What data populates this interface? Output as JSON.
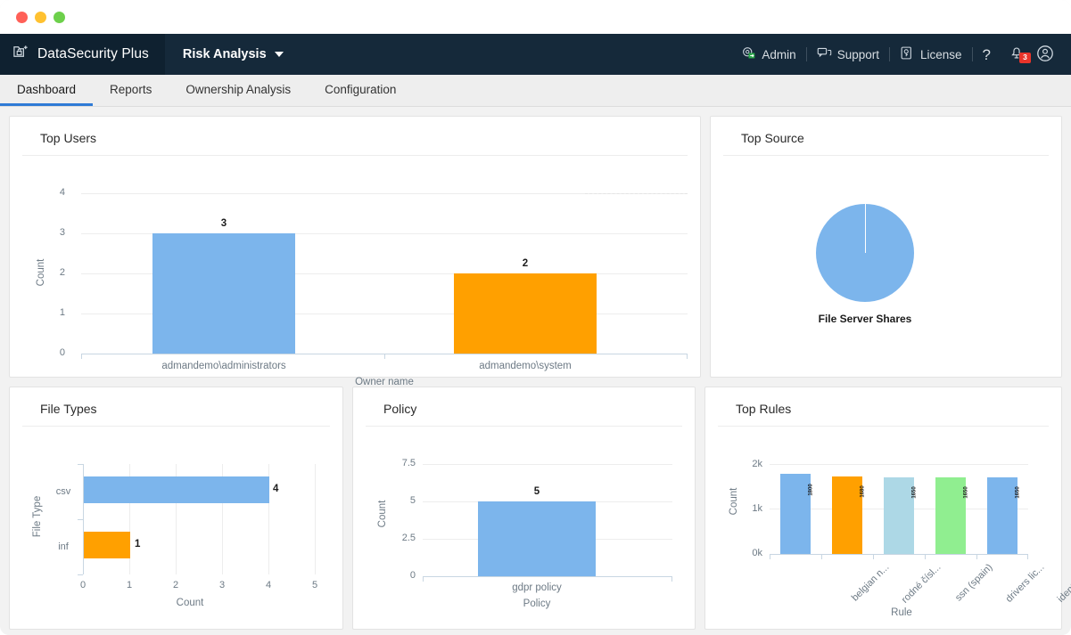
{
  "window": {
    "traffic_lights": [
      "close",
      "minimize",
      "zoom"
    ]
  },
  "header": {
    "brand": "DataSecurity Plus",
    "brand_icon": "folder-lock-add-icon",
    "module": "Risk Analysis",
    "module_caret": "chevron-down-icon",
    "right_items": [
      {
        "label": "Admin",
        "icon": "admin-gear-icon"
      },
      {
        "label": "Support",
        "icon": "support-chat-icon"
      },
      {
        "label": "License",
        "icon": "license-key-icon"
      }
    ],
    "help_icon": "question-mark-icon",
    "notification_icon": "notification-bell-icon",
    "notification_count": "3",
    "profile_icon": "user-avatar-icon"
  },
  "tabs": [
    {
      "label": "Dashboard",
      "active": true
    },
    {
      "label": "Reports",
      "active": false
    },
    {
      "label": "Ownership Analysis",
      "active": false
    },
    {
      "label": "Configuration",
      "active": false
    }
  ],
  "colors": {
    "blue": "#7cb5ec",
    "orange": "#ffa000",
    "light_blue": "#add8e6",
    "green": "#90ee90",
    "accent": "#2f7bd6",
    "header_bg": "#15293a"
  },
  "cards": {
    "top_users": {
      "title": "Top Users"
    },
    "top_source": {
      "title": "Top Source"
    },
    "file_types": {
      "title": "File Types"
    },
    "policy": {
      "title": "Policy"
    },
    "top_rules": {
      "title": "Top Rules"
    }
  },
  "chart_data": [
    {
      "id": "top_users",
      "type": "bar",
      "title": "Top Users",
      "xlabel": "Owner name",
      "ylabel": "Count",
      "ylim": [
        0,
        4
      ],
      "yticks": [
        "0",
        "1",
        "2",
        "3",
        "4"
      ],
      "grid": true,
      "categories": [
        "admandemo\\administrators",
        "admandemo\\system"
      ],
      "values": [
        3,
        2
      ],
      "value_labels": [
        "3",
        "2"
      ],
      "colors": [
        "#7cb5ec",
        "#ffa000"
      ]
    },
    {
      "id": "top_source",
      "type": "pie",
      "title": "Top Source",
      "labels": [
        "File Server Shares"
      ],
      "values": [
        100
      ],
      "value_labels": [
        "File Server Shares"
      ],
      "colors": [
        "#7cb5ec"
      ],
      "legend": "below"
    },
    {
      "id": "file_types",
      "type": "bar",
      "orientation": "horizontal",
      "title": "File Types",
      "xlabel": "Count",
      "ylabel": "File Type",
      "xlim": [
        0,
        5
      ],
      "xticks": [
        "0",
        "1",
        "2",
        "3",
        "4",
        "5"
      ],
      "grid": true,
      "categories": [
        "csv",
        "inf"
      ],
      "values": [
        4,
        1
      ],
      "value_labels": [
        "4",
        "1"
      ],
      "colors": [
        "#7cb5ec",
        "#ffa000"
      ]
    },
    {
      "id": "policy",
      "type": "bar",
      "title": "Policy",
      "xlabel": "Policy",
      "ylabel": "Count",
      "ylim": [
        0,
        7.5
      ],
      "yticks": [
        "0",
        "2.5",
        "5",
        "7.5"
      ],
      "grid": true,
      "categories": [
        "gdpr policy"
      ],
      "values": [
        5
      ],
      "value_labels": [
        "5"
      ],
      "colors": [
        "#7cb5ec"
      ]
    },
    {
      "id": "top_rules",
      "type": "bar",
      "title": "Top Rules",
      "xlabel": "Rule",
      "ylabel": "Count",
      "ylim": [
        0,
        2000
      ],
      "yticks": [
        "0k",
        "1k",
        "2k"
      ],
      "grid": true,
      "categories": [
        "belgian n...",
        "rodné čísl...",
        "ssn (spain)",
        "drivers lic...",
        "identifikat..."
      ],
      "values": [
        1800,
        1680,
        1650,
        1650,
        1650
      ],
      "value_labels": [
        "1800",
        "1680",
        "1650",
        "1650",
        "1650"
      ],
      "colors": [
        "#7cb5ec",
        "#ffa000",
        "#add8e6",
        "#90ee90",
        "#7cb5ec"
      ]
    }
  ]
}
